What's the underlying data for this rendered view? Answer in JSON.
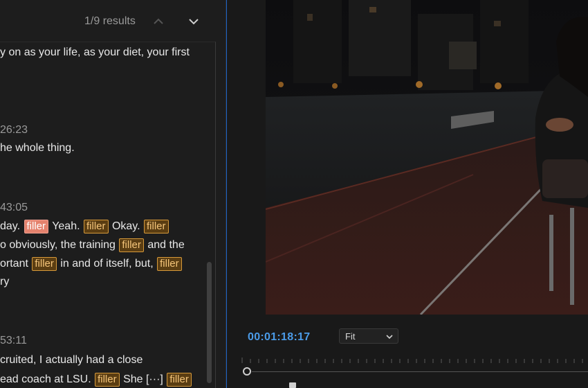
{
  "search": {
    "results_count": "1/9 results",
    "prev_icon": "chevron-up",
    "next_icon": "chevron-down"
  },
  "transcript": {
    "line_1": "y on as your life, as your diet, your first",
    "ts_1": "26:23",
    "line_2": "he whole thing.",
    "ts_2": "43:05",
    "p3_1_a": "day.",
    "p3_1_b": "Yeah.",
    "p3_1_c": "Okay.",
    "p3_2_a": "o obviously, the training",
    "p3_2_b": "and the",
    "p3_3_a": "ortant",
    "p3_3_b": "in and of itself, but,",
    "p3_4": "ry",
    "ts_3": "53:11",
    "p4_1": "cruited, I actually had a close",
    "p4_2_a": "ead coach at LSU.",
    "p4_2_b": "She",
    "p4_2_c": "[···]",
    "tag_label": "filler"
  },
  "monitor": {
    "timecode": "00:01:18:17",
    "zoom_option": "Fit",
    "zoom_icon": "chevron-down"
  },
  "colors": {
    "accent_blue": "#4b9be8",
    "filler_tag": "#d79a3a",
    "filler_tag_active": "#e4826d"
  }
}
